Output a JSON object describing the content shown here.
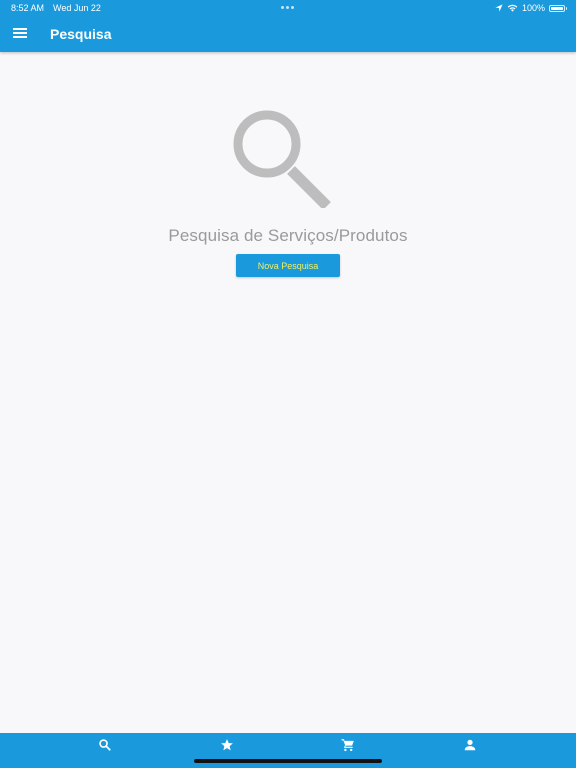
{
  "status_bar": {
    "time": "8:52 AM",
    "date": "Wed Jun 22",
    "battery_percent": "100%",
    "battery_level": 1.0
  },
  "app_bar": {
    "menu_icon": "hamburger-menu-icon",
    "title": "Pesquisa"
  },
  "empty_state": {
    "icon": "magnifier-icon",
    "title": "Pesquisa de Serviços/Produtos",
    "button_label": "Nova Pesquisa"
  },
  "bottom_nav": {
    "items": [
      {
        "icon": "search-icon"
      },
      {
        "icon": "star-icon"
      },
      {
        "icon": "cart-icon"
      },
      {
        "icon": "person-icon"
      }
    ]
  },
  "colors": {
    "primary": "#1a99dc",
    "button_text": "#f4f05a",
    "muted_text": "#9a9a9a",
    "icon_gray": "#bdbdbd",
    "background": "#f8f8fa"
  }
}
